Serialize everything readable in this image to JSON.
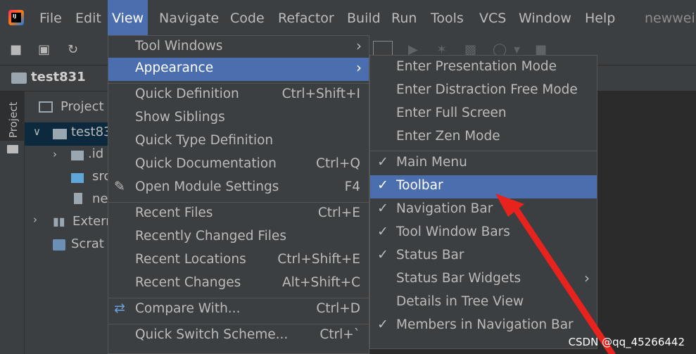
{
  "menubar": {
    "items": [
      "File",
      "Edit",
      "View",
      "Navigate",
      "Code",
      "Refactor",
      "Build",
      "Run",
      "Tools",
      "VCS",
      "Window",
      "Help"
    ],
    "project_name": "newwei"
  },
  "navbar": {
    "crumb": "test831"
  },
  "sidebar": {
    "tab_label": "Project"
  },
  "tree": {
    "header": "Project",
    "root": "test83",
    "child1": ".id",
    "child2": "src",
    "child3": "ne",
    "external": "Extern",
    "scratches": "Scrat"
  },
  "view_menu": {
    "tool_windows": "Tool Windows",
    "appearance": "Appearance",
    "quick_definition": "Quick Definition",
    "quick_definition_sc": "Ctrl+Shift+I",
    "show_siblings": "Show Siblings",
    "quick_type_definition": "Quick Type Definition",
    "quick_documentation": "Quick Documentation",
    "quick_documentation_sc": "Ctrl+Q",
    "open_module_settings": "Open Module Settings",
    "open_module_settings_sc": "F4",
    "recent_files": "Recent Files",
    "recent_files_sc": "Ctrl+E",
    "recently_changed_files": "Recently Changed Files",
    "recent_locations": "Recent Locations",
    "recent_locations_sc": "Ctrl+Shift+E",
    "recent_changes": "Recent Changes",
    "recent_changes_sc": "Alt+Shift+C",
    "compare_with": "Compare With...",
    "compare_with_sc": "Ctrl+D",
    "quick_switch_scheme": "Quick Switch Scheme...",
    "quick_switch_scheme_sc": "Ctrl+`"
  },
  "appearance_menu": {
    "presentation": "Enter Presentation Mode",
    "distraction_free": "Enter Distraction Free Mode",
    "full_screen": "Enter Full Screen",
    "zen": "Enter Zen Mode",
    "main_menu": "Main Menu",
    "toolbar": "Toolbar",
    "navigation_bar": "Navigation Bar",
    "tool_window_bars": "Tool Window Bars",
    "status_bar": "Status Bar",
    "status_bar_widgets": "Status Bar Widgets",
    "details_in_tree_view": "Details in Tree View",
    "members_in_navigation_bar": "Members in Navigation Bar"
  },
  "watermark": "CSDN @qq_45266442",
  "colors": {
    "menu_bg": "#3c3f41",
    "highlight": "#4b6eaf",
    "editor_bg": "#2b2b2b",
    "arrow": "#e8231e"
  }
}
